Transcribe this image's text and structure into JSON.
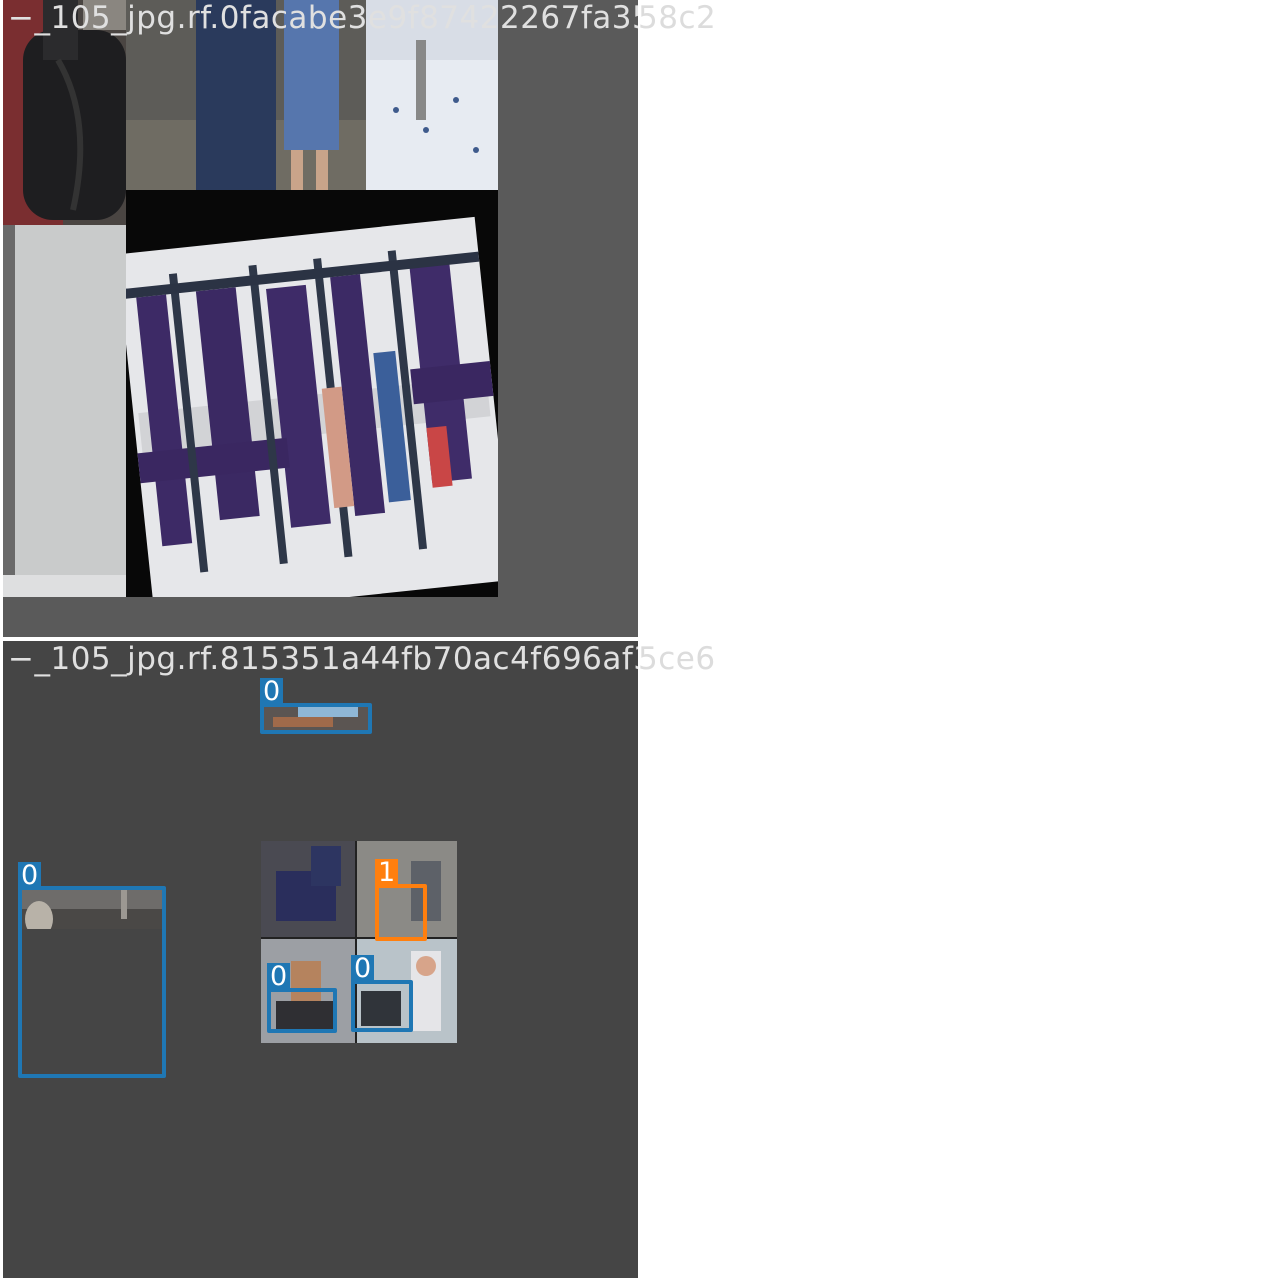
{
  "tiles": [
    {
      "title": "−_105_jpg.rf.0facabe3e9f87422267fa3558c2",
      "title_visible": "−_105_jpg.rf.0facabe3e9f87422267fa35",
      "title_overflow": "58c2",
      "detections": []
    },
    {
      "title": "−_105_jpg.rf.815351a44fb70ac4f696af35ce6",
      "title_visible": "−_105_jpg.rf.815351a44fb70ac4f696af3",
      "title_overflow": "5ce6",
      "detections": [
        {
          "class_label": "0",
          "color": "#1f77b4"
        },
        {
          "class_label": "0",
          "color": "#1f77b4"
        },
        {
          "class_label": "1",
          "color": "#ff7f0e"
        },
        {
          "class_label": "0",
          "color": "#1f77b4"
        },
        {
          "class_label": "0",
          "color": "#1f77b4"
        }
      ]
    }
  ],
  "colors": {
    "page_background": "#ffffff",
    "tile_1_background": "#5a5a5a",
    "tile_2_background": "#454545",
    "class_0": "#1f77b4",
    "class_1": "#ff7f0e"
  }
}
